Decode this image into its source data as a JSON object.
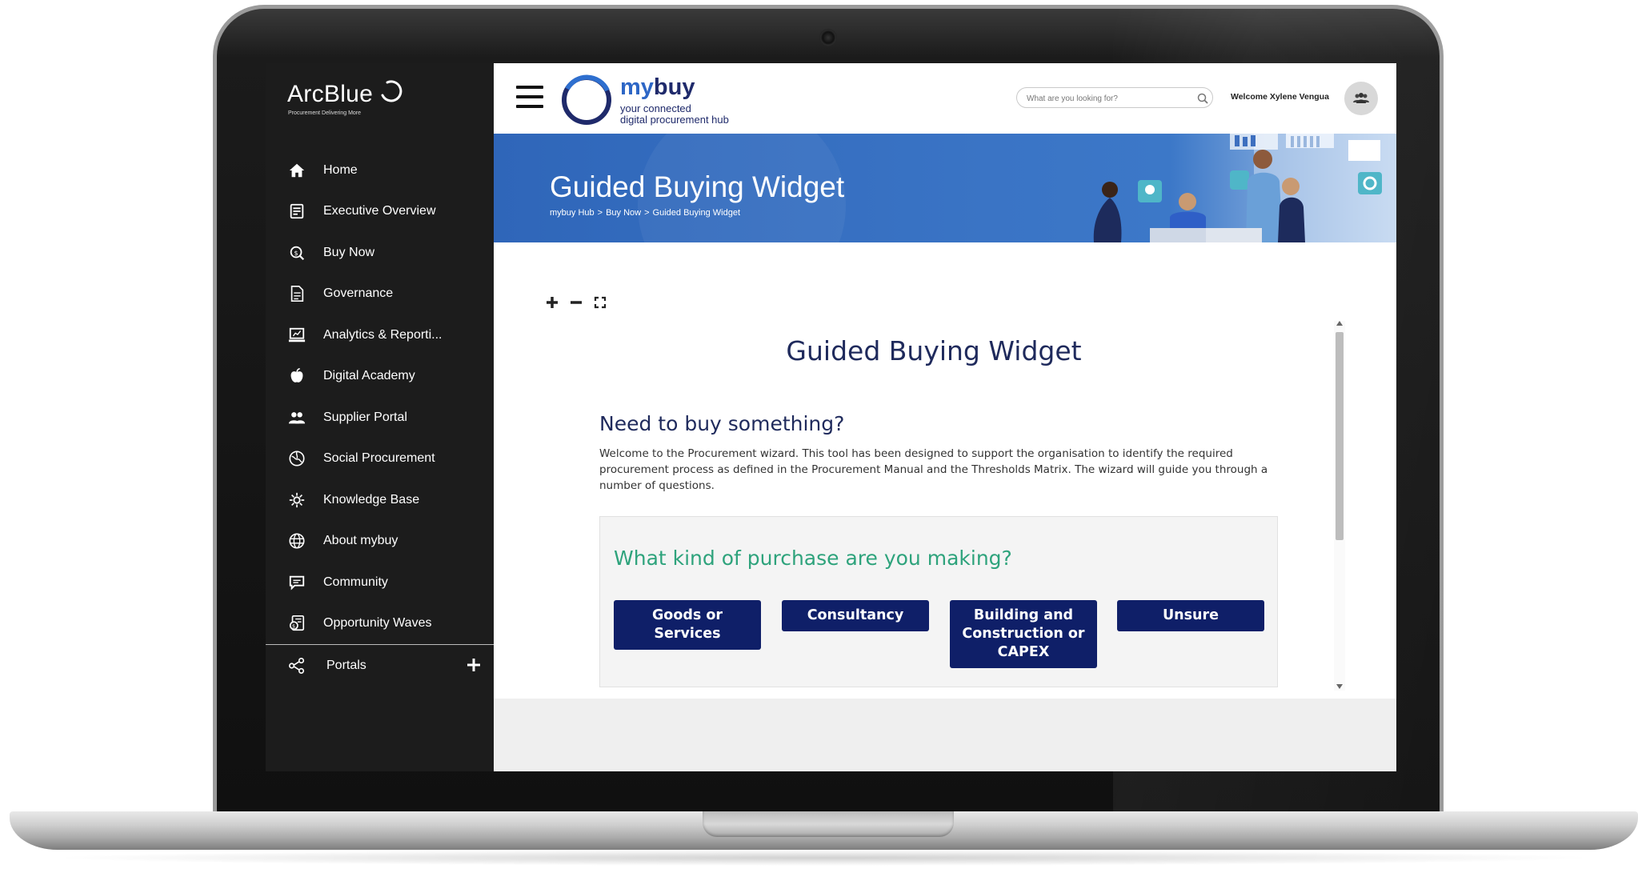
{
  "sidebar": {
    "logo": {
      "word": "ArcBlue",
      "tagline": "Procurement Delivering More"
    },
    "items": [
      {
        "label": "Home",
        "icon": "home-icon"
      },
      {
        "label": "Executive Overview",
        "icon": "report-icon"
      },
      {
        "label": "Buy Now",
        "icon": "buy-now-icon"
      },
      {
        "label": "Governance",
        "icon": "document-icon"
      },
      {
        "label": "Analytics & Reporti...",
        "icon": "laptop-chart-icon"
      },
      {
        "label": "Digital Academy",
        "icon": "academy-icon"
      },
      {
        "label": "Supplier Portal",
        "icon": "users-icon"
      },
      {
        "label": "Social Procurement",
        "icon": "globe-leaf-icon"
      },
      {
        "label": "Knowledge Base",
        "icon": "knowledge-icon"
      },
      {
        "label": "About mybuy",
        "icon": "globe-icon"
      },
      {
        "label": "Community",
        "icon": "chat-icon"
      },
      {
        "label": "Opportunity Waves",
        "icon": "opportunity-icon"
      }
    ],
    "portals": {
      "label": "Portals",
      "icon": "share-icon",
      "action_icon": "plus-icon"
    }
  },
  "header": {
    "brand": {
      "name_a": "my",
      "name_b": "buy",
      "tagline_1": "your connected",
      "tagline_2": "digital procurement hub"
    },
    "search": {
      "placeholder": "What are you looking for?"
    },
    "welcome": "Welcome Xylene Vengua"
  },
  "banner": {
    "title": "Guided Buying Widget",
    "breadcrumb": [
      "mybuy Hub",
      "Buy Now",
      "Guided Buying Widget"
    ],
    "separator": ">"
  },
  "widget": {
    "title": "Guided Buying Widget",
    "heading": "Need to buy something?",
    "intro": "Welcome to the Procurement wizard. This tool has been designed to support the organisation to identify the required procurement process as defined in the Procurement Manual and the Thresholds Matrix. The wizard will guide you through a number of questions.",
    "question": "What kind of purchase are you making?",
    "choices": [
      "Goods or Services",
      "Consultancy",
      "Building and Construction or CAPEX",
      "Unsure"
    ]
  },
  "colors": {
    "sidebar_bg": "#1c1c1c",
    "banner_blue": "#2f66b9",
    "navy": "#1f2a5c",
    "button_navy": "#0f1f68",
    "question_green": "#2ea37c"
  }
}
